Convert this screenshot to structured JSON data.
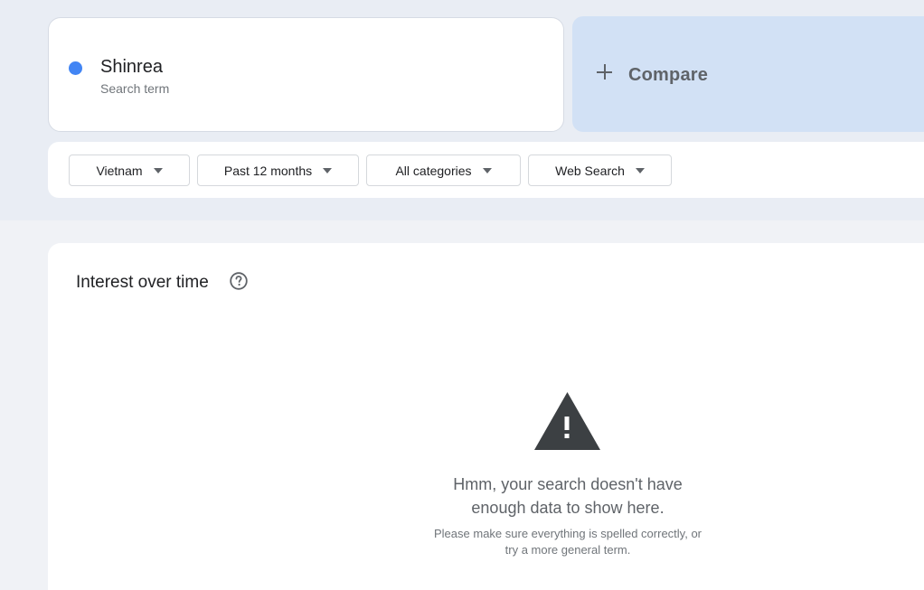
{
  "term": {
    "name": "Shinrea",
    "type": "Search term",
    "color": "#4285f4"
  },
  "compare": {
    "label": "Compare",
    "icon": "plus-icon"
  },
  "filters": [
    {
      "label": "Vietnam",
      "icon": "caret-down-icon"
    },
    {
      "label": "Past 12 months",
      "icon": "caret-down-icon"
    },
    {
      "label": "All categories",
      "icon": "caret-down-icon"
    },
    {
      "label": "Web Search",
      "icon": "caret-down-icon"
    }
  ],
  "interest": {
    "title": "Interest over time",
    "help_icon": "help-circle-icon",
    "empty": {
      "icon": "warning-icon",
      "title_line1": "Hmm, your search doesn't have",
      "title_line2": "enough data to show here.",
      "sub_line1": "Please make sure everything is spelled correctly, or",
      "sub_line2": "try a more general term."
    }
  }
}
